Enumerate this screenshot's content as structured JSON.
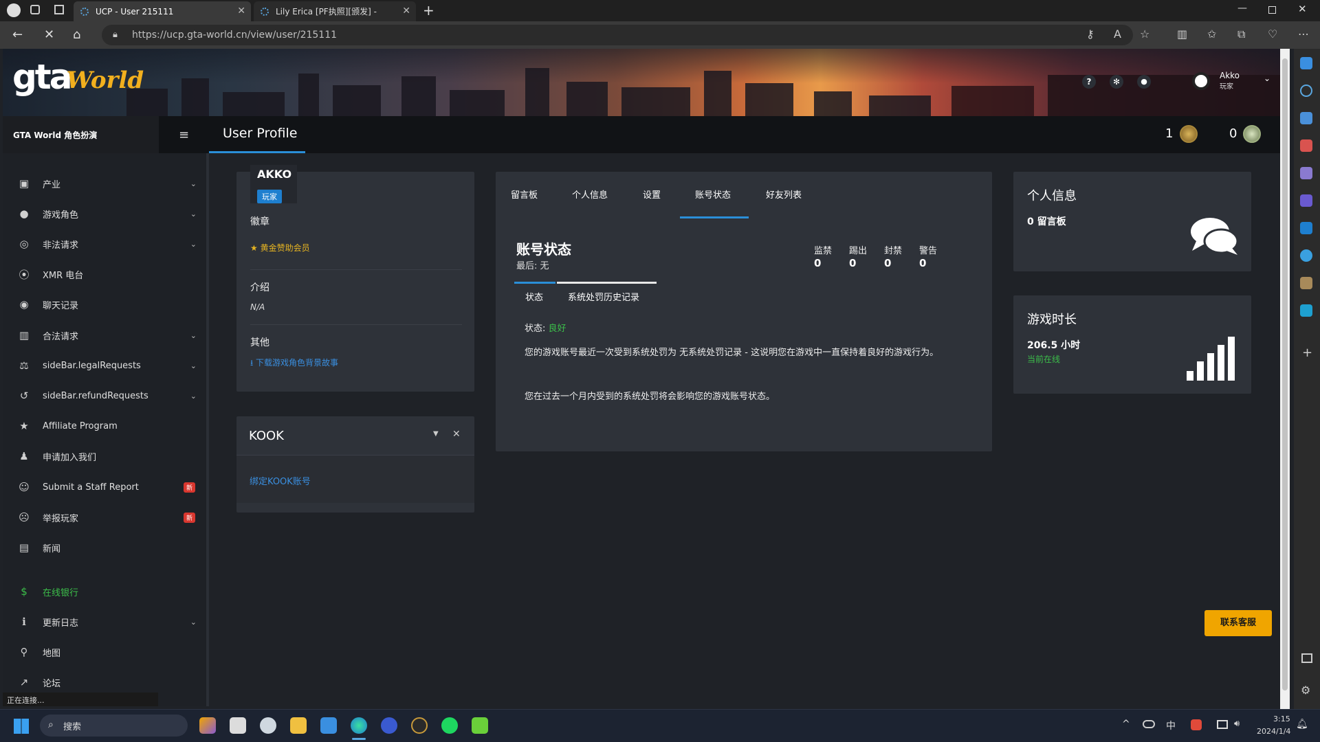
{
  "browser": {
    "tabs": [
      {
        "title": "UCP - User 215111"
      },
      {
        "title": "Lily Erica [PF执照][颁发] -"
      }
    ],
    "url": "https://ucp.gta-world.cn/view/user/215111",
    "status_text": "正在连接..."
  },
  "header": {
    "logo_text": "gta",
    "logo_sub": "World",
    "user_name": "Akko",
    "user_role": "玩家"
  },
  "nav": {
    "brand": "GTA World 角色扮演",
    "page_title": "User Profile",
    "counter_a": "1",
    "counter_b": "0"
  },
  "sidebar": {
    "items": [
      {
        "label": "产业",
        "icon": "briefcase-icon",
        "chev": true
      },
      {
        "label": "游戏角色",
        "icon": "user-icon",
        "chev": true
      },
      {
        "label": "非法请求",
        "icon": "mask-icon",
        "chev": true
      },
      {
        "label": "XMR 电台",
        "icon": "radio-icon",
        "chev": false
      },
      {
        "label": "聊天记录",
        "icon": "chat-icon",
        "chev": false
      },
      {
        "label": "合法请求",
        "icon": "building-icon",
        "chev": true
      },
      {
        "label": "sideBar.legalRequests",
        "icon": "scale-icon",
        "chev": true
      },
      {
        "label": "sideBar.refundRequests",
        "icon": "undo-icon",
        "chev": true
      },
      {
        "label": "Affiliate Program",
        "icon": "star-icon",
        "chev": false
      },
      {
        "label": "申请加入我们",
        "icon": "user-tie-icon",
        "chev": false
      },
      {
        "label": "Submit a Staff Report",
        "icon": "smile-icon",
        "chev": false,
        "badge": "新"
      },
      {
        "label": "举报玩家",
        "icon": "frown-icon",
        "chev": false,
        "badge": "新"
      },
      {
        "label": "新闻",
        "icon": "newspaper-icon",
        "chev": false
      },
      {
        "label": "在线银行",
        "icon": "dollar-icon",
        "chev": false
      },
      {
        "label": "更新日志",
        "icon": "info-icon",
        "chev": true
      },
      {
        "label": "地图",
        "icon": "map-pin-icon",
        "chev": false
      },
      {
        "label": "论坛",
        "icon": "external-link-icon",
        "chev": false
      }
    ]
  },
  "profile": {
    "name": "AKKO",
    "role_badge": "玩家",
    "badges_label": "徽章",
    "badge_item": "黄金赞助会员",
    "intro_label": "介绍",
    "intro_value": "N/A",
    "other_label": "其他",
    "download_link": "下载游戏角色背景故事"
  },
  "kook": {
    "title": "KOOK",
    "bind_link": "绑定KOOK账号"
  },
  "main": {
    "tabs": [
      "留言板",
      "个人信息",
      "设置",
      "账号状态",
      "好友列表"
    ],
    "active_tab": "账号状态",
    "section_title": "账号状态",
    "last_label": "最后: 无",
    "stats": [
      {
        "label": "监禁",
        "value": "0"
      },
      {
        "label": "踢出",
        "value": "0"
      },
      {
        "label": "封禁",
        "value": "0"
      },
      {
        "label": "警告",
        "value": "0"
      }
    ],
    "subtabs": [
      "状态",
      "系统处罚历史记录"
    ],
    "status_label": "状态:",
    "status_value": "良好",
    "status_color": "#3cbf4a",
    "para1": "您的游戏账号最近一次受到系统处罚为 无系统处罚记录 - 这说明您在游戏中一直保持着良好的游戏行为。",
    "para2": "您在过去一个月内受到的系统处罚将会影响您的游戏账号状态。"
  },
  "info_card": {
    "title": "个人信息",
    "value": "0 留言板"
  },
  "playtime_card": {
    "title": "游戏时长",
    "value": "206.5 小时",
    "sub": "当前在线",
    "sub_color": "#3cbf4a"
  },
  "support_button": "联系客服",
  "taskbar": {
    "search_placeholder": "搜索",
    "ime": "中",
    "time": "3:15",
    "date": "2024/1/4"
  },
  "colors": {
    "accent": "#2a8fd8",
    "badge_blue": "#1e7fcf",
    "gold": "#e6b422",
    "support": "#f0a500",
    "link": "#3a8fe0"
  }
}
